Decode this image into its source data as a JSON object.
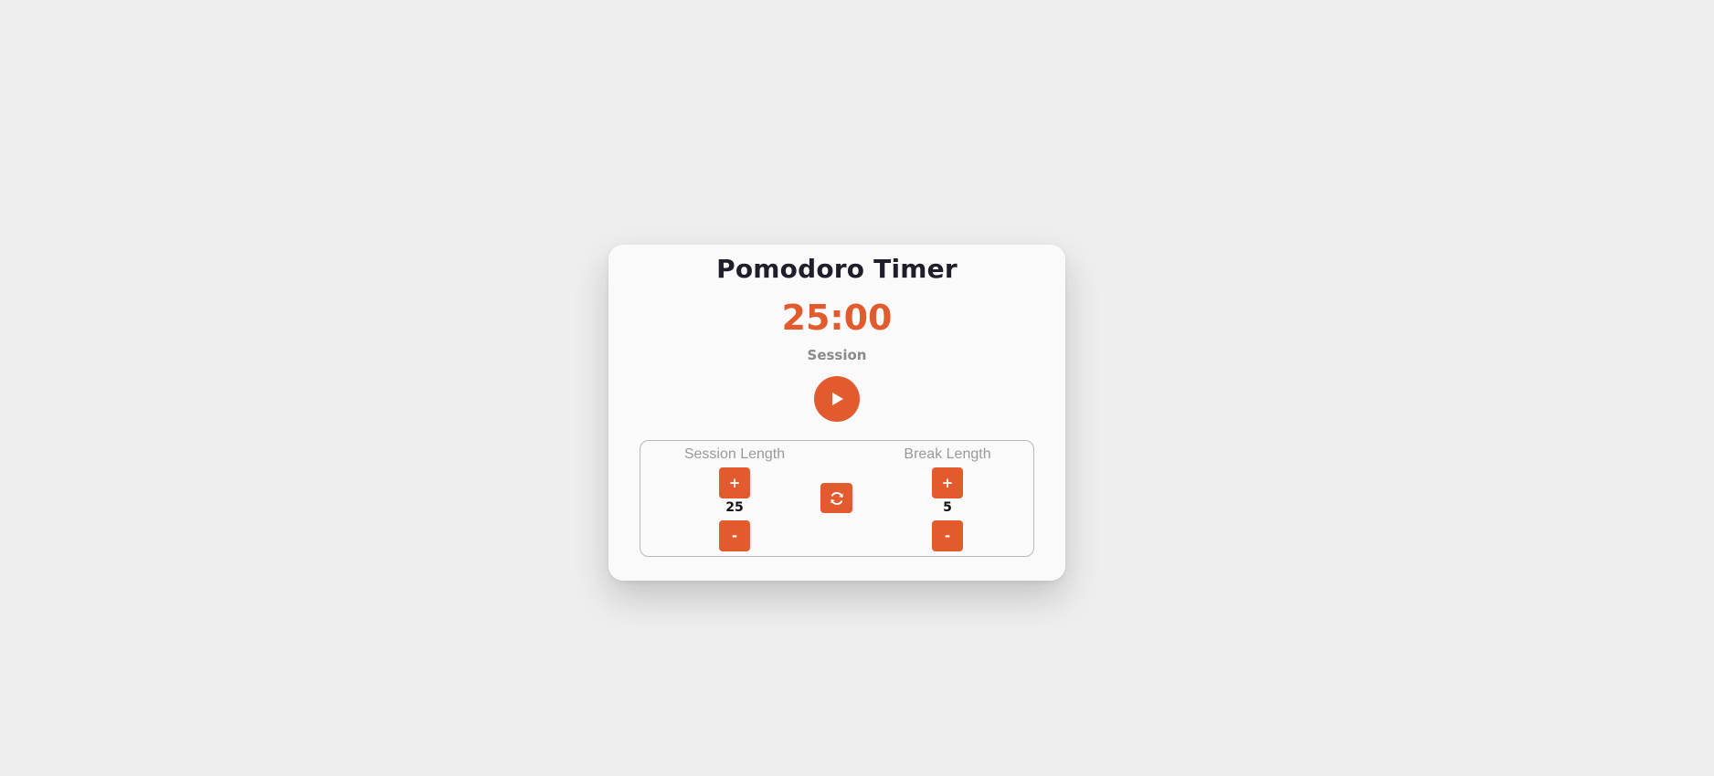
{
  "app": {
    "title": "Pomodoro Timer",
    "accent_color": "#e15b2e"
  },
  "timer": {
    "display": "25:00",
    "mode_label": "Session",
    "play_icon": "play-icon"
  },
  "session": {
    "label": "Session Length",
    "value": "25",
    "increment_label": "+",
    "decrement_label": "-"
  },
  "break": {
    "label": "Break Length",
    "value": "5",
    "increment_label": "+",
    "decrement_label": "-"
  },
  "reset": {
    "icon": "refresh-icon"
  }
}
